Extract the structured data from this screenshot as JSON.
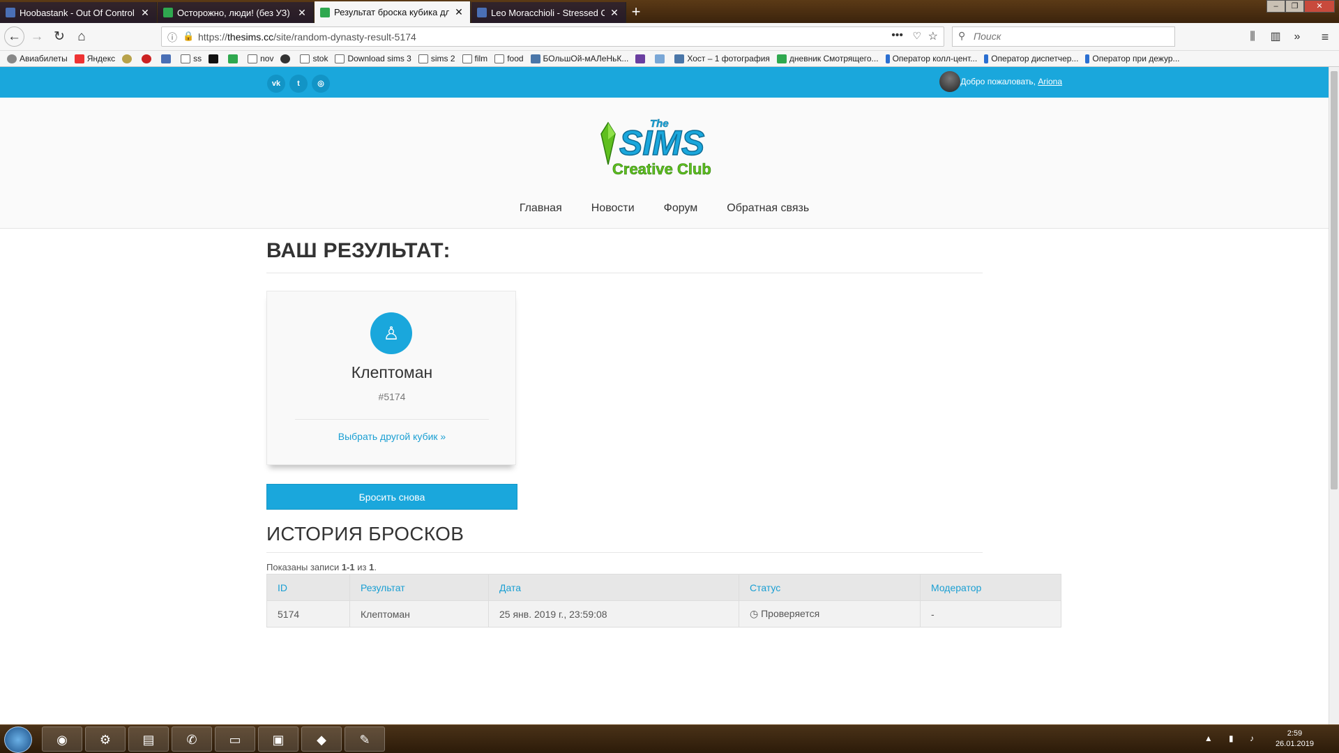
{
  "browser": {
    "tabs": [
      {
        "title": "Hoobastank - Out Of Control",
        "active": false
      },
      {
        "title": "Осторожно, люди! (без УЗ) | С",
        "active": false
      },
      {
        "title": "Результат броска кубика для ,",
        "active": true
      },
      {
        "title": "Leo Moracchioli - Stressed Out",
        "active": false
      }
    ],
    "url_prefix": "https://",
    "url_domain": "thesims.cc",
    "url_path": "/site/random-dynasty-result-5174",
    "search_placeholder": "Поиск",
    "bookmarks": [
      "Авиабилеты",
      "Яндекс",
      "",
      "",
      "",
      "ss",
      "",
      "",
      "nov",
      "",
      "stok",
      "Download sims 3",
      "sims 2",
      "film",
      "food",
      "БОльшОй-мАЛеНьК...",
      "",
      "",
      "Хост – 1 фотография",
      "дневник Смотрящего...",
      "Оператор колл-цент...",
      "Оператор диспетчер...",
      "Оператор при дежур..."
    ]
  },
  "site": {
    "social": [
      "vk-icon",
      "twitter-icon",
      "instagram-icon"
    ],
    "welcome_text": "Добро пожаловать, ",
    "username": "Ariona",
    "logo_the": "The",
    "logo_sims": "SIMS",
    "logo_sub": "Creative Club",
    "nav": [
      "Главная",
      "Новости",
      "Форум",
      "Обратная связь"
    ]
  },
  "result": {
    "heading": "ВАШ РЕЗУЛЬТАТ:",
    "card_title": "Клептоман",
    "card_number": "#5174",
    "card_link": "Выбрать другой кубик »",
    "roll_again": "Бросить снова"
  },
  "history": {
    "heading": "ИСТОРИЯ БРОСКОВ",
    "summary_prefix": "Показаны записи ",
    "summary_range": "1-1",
    "summary_mid": " из ",
    "summary_total": "1",
    "summary_end": ".",
    "columns": [
      "ID",
      "Результат",
      "Дата",
      "Статус",
      "Модератор"
    ],
    "rows": [
      {
        "id": "5174",
        "result": "Клептоман",
        "date": "25 янв. 2019 г., 23:59:08",
        "status": "Проверяется",
        "moderator": "-"
      }
    ]
  },
  "taskbar": {
    "time": "2:59",
    "date": "26.01.2019"
  },
  "colors": {
    "accent": "#1aa7dc",
    "link": "#1a9fd3",
    "logo_green": "#5fbf1f"
  }
}
